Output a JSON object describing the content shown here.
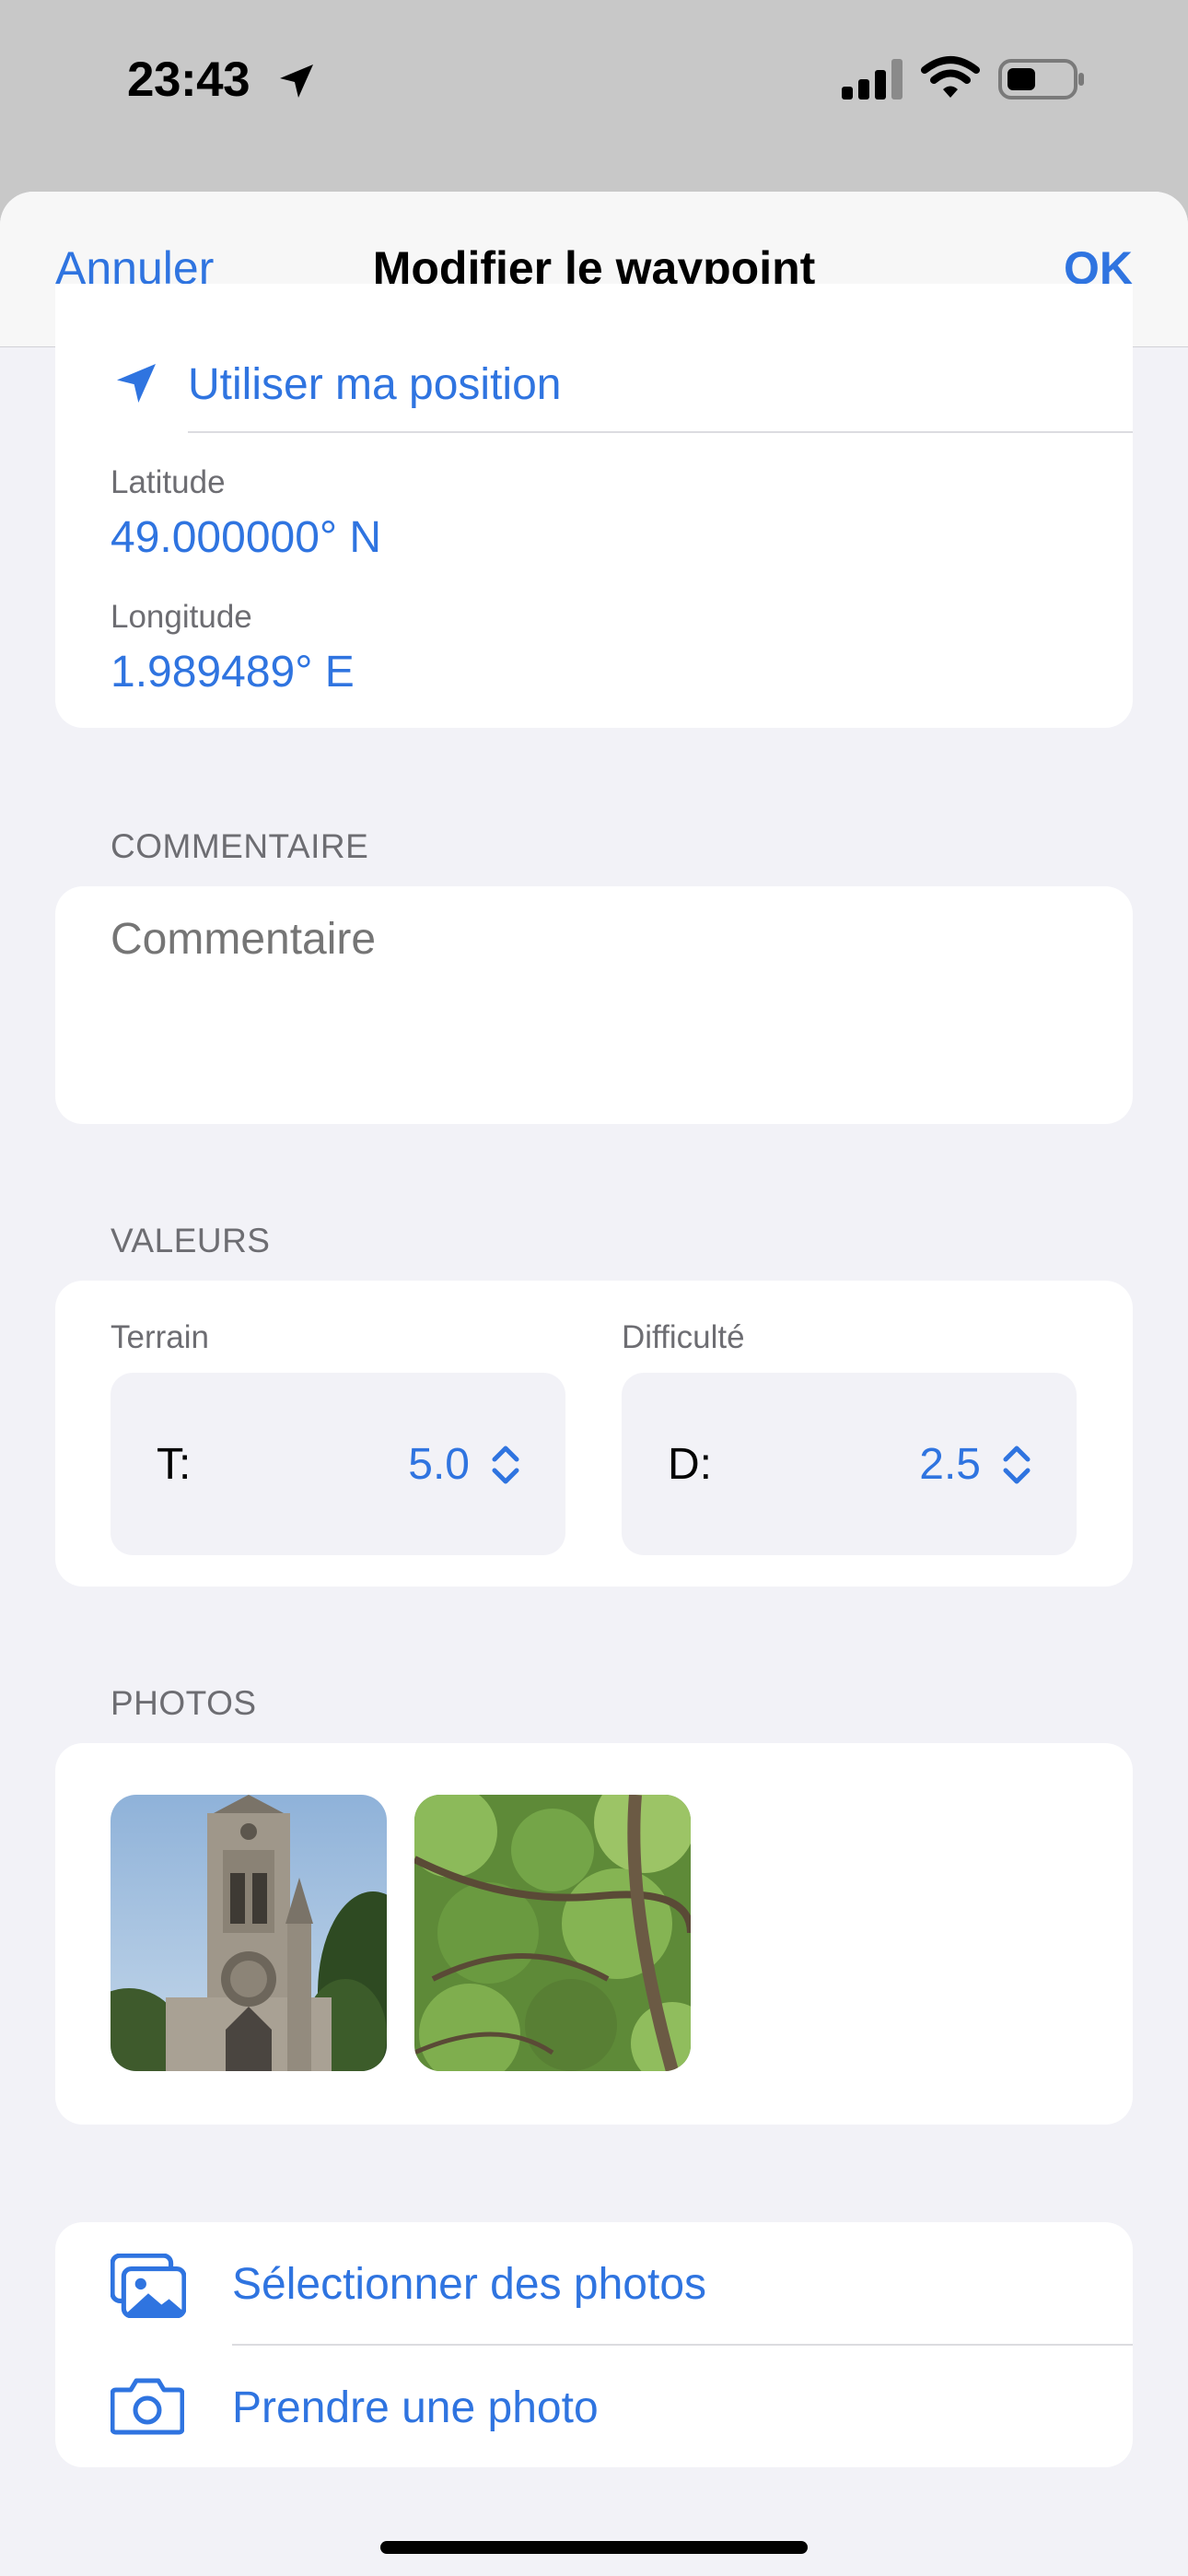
{
  "status_bar": {
    "time": "23:43",
    "icons": [
      "location-arrow-icon",
      "cellular-signal-icon",
      "wifi-icon",
      "battery-icon"
    ]
  },
  "nav": {
    "cancel_label": "Annuler",
    "title": "Modifier le waypoint",
    "ok_label": "OK"
  },
  "position": {
    "use_location_label": "Utiliser ma position",
    "latitude_label": "Latitude",
    "latitude_value": "49.000000° N",
    "longitude_label": "Longitude",
    "longitude_value": "1.989489° E"
  },
  "comment": {
    "header": "COMMENTAIRE",
    "placeholder": "Commentaire",
    "value": ""
  },
  "values": {
    "header": "VALEURS",
    "terrain": {
      "label": "Terrain",
      "prefix": "T:",
      "value": "5.0"
    },
    "difficulty": {
      "label": "Difficulté",
      "prefix": "D:",
      "value": "2.5"
    }
  },
  "photos": {
    "header": "PHOTOS",
    "items": [
      {
        "subject": "church-tower"
      },
      {
        "subject": "tree-branches"
      }
    ]
  },
  "actions": {
    "select_photos_label": "Sélectionner des photos",
    "take_photo_label": "Prendre une photo"
  },
  "colors": {
    "accent": "#2f74e0",
    "background": "#f2f2f7",
    "card": "#ffffff",
    "secondary_text": "#6d6d72"
  }
}
